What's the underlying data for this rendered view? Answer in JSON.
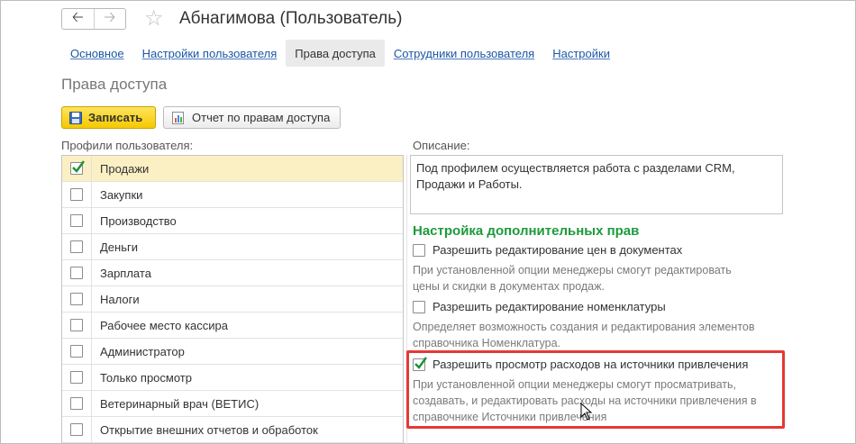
{
  "header": {
    "back_icon": "arrow-left-icon",
    "forward_icon": "arrow-right-icon",
    "favorite_icon": "star-icon",
    "title": "Абнагимова (Пользователь)"
  },
  "tabs": [
    {
      "label": "Основное",
      "active": false
    },
    {
      "label": "Настройки пользователя",
      "active": false
    },
    {
      "label": "Права доступа",
      "active": true
    },
    {
      "label": "Сотрудники пользователя",
      "active": false
    },
    {
      "label": "Настройки",
      "active": false
    }
  ],
  "section_title": "Права доступа",
  "toolbar": {
    "save_label": "Записать",
    "report_label": "Отчет по правам доступа"
  },
  "profiles": {
    "label": "Профили пользователя:",
    "items": [
      {
        "name": "Продажи",
        "checked": true,
        "selected": true
      },
      {
        "name": "Закупки",
        "checked": false
      },
      {
        "name": "Производство",
        "checked": false
      },
      {
        "name": "Деньги",
        "checked": false
      },
      {
        "name": "Зарплата",
        "checked": false
      },
      {
        "name": "Налоги",
        "checked": false
      },
      {
        "name": "Рабочее место кассира",
        "checked": false
      },
      {
        "name": "Администратор",
        "checked": false
      },
      {
        "name": "Только просмотр",
        "checked": false
      },
      {
        "name": "Ветеринарный врач (ВЕТИС)",
        "checked": false
      },
      {
        "name": "Открытие внешних отчетов и обработок",
        "checked": false
      }
    ]
  },
  "description": {
    "label": "Описание:",
    "text": "Под профилем осуществляется работа с разделами CRM, Продажи и Работы."
  },
  "extra_rights": {
    "heading": "Настройка дополнительных прав",
    "options": [
      {
        "label": "Разрешить редактирование цен в документах",
        "checked": false,
        "hint_lines": [
          "При установленной опции менеджеры смогут редактировать",
          "цены и скидки в документах продаж."
        ]
      },
      {
        "label": "Разрешить редактирование номенклатуры",
        "checked": false,
        "hint_lines": [
          "Определяет возможность создания и редактирования элементов",
          "справочника Номенклатура."
        ]
      },
      {
        "label": "Разрешить просмотр расходов на источники привлечения",
        "checked": true,
        "hint_lines": [
          "При установленной опции менеджеры смогут просматривать,",
          "создавать, и редактировать расходы на источники привлечения в",
          "справочнике Источники привлечения"
        ]
      }
    ]
  },
  "colors": {
    "accent_heading": "#1d9a3c",
    "highlight_border": "#e53935",
    "selected_row": "#fbefc4",
    "save_button": "#f4c900",
    "link": "#1c57a5"
  }
}
